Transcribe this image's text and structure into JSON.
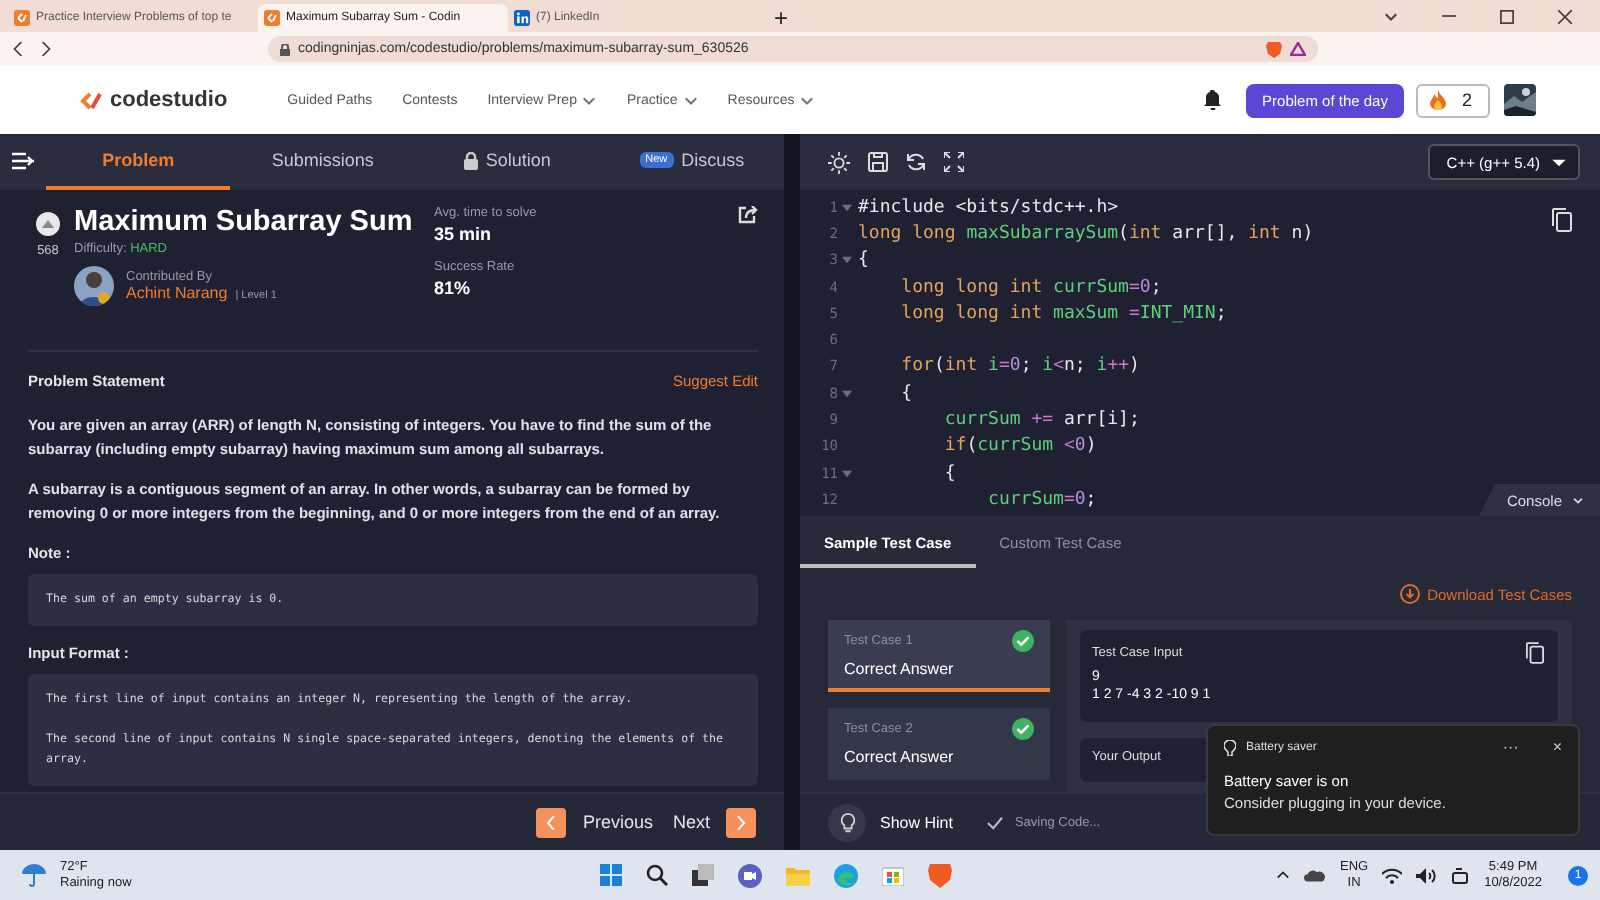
{
  "browser": {
    "tabs": [
      {
        "title": "Practice Interview Problems of top te",
        "selected": false,
        "kind": "codestudio"
      },
      {
        "title": "Maximum Subarray Sum - Codin",
        "selected": true,
        "kind": "codestudio"
      },
      {
        "title": "(7) LinkedIn",
        "selected": false,
        "kind": "linkedin"
      }
    ],
    "new_tab": "+",
    "url": "codingninjas.com/codestudio/problems/maximum-subarray-sum_630526"
  },
  "header": {
    "logo": "codestudio",
    "nav": [
      {
        "label": "Guided Paths",
        "dropdown": false
      },
      {
        "label": "Contests",
        "dropdown": false
      },
      {
        "label": "Interview Prep",
        "dropdown": true
      },
      {
        "label": "Practice",
        "dropdown": true
      },
      {
        "label": "Resources",
        "dropdown": true
      }
    ],
    "problem_of_day": "Problem of the day",
    "streak": "2"
  },
  "workspace_tabs": [
    {
      "label": "Problem",
      "selected": true,
      "kind": "plain"
    },
    {
      "label": "Submissions",
      "selected": false,
      "kind": "plain"
    },
    {
      "label": "Solution",
      "selected": false,
      "kind": "locked"
    },
    {
      "label": "Discuss",
      "selected": false,
      "kind": "badge",
      "badge": "New"
    }
  ],
  "language": "C++ (g++ 5.4)",
  "problem": {
    "title": "Maximum Subarray Sum",
    "number": "568",
    "difficulty_label": "Difficulty:",
    "difficulty": "HARD",
    "contributed_by": "Contributed By",
    "author": "Achint Narang",
    "author_level": "| Level 1",
    "stats": [
      {
        "label": "Avg. time to solve",
        "value": "35 min"
      },
      {
        "label": "Success Rate",
        "value": "81%"
      }
    ],
    "statement_heading": "Problem Statement",
    "suggest_edit": "Suggest Edit",
    "paragraphs": [
      "You are given an array (ARR) of length N, consisting of integers. You have to find the sum of the subarray (including empty subarray) having maximum sum among all subarrays.",
      "A subarray is a contiguous segment of an array. In other words, a subarray can be formed by removing 0 or more integers from the beginning, and 0 or more integers from the end of an array."
    ],
    "sections": [
      {
        "heading": "Note :",
        "lines": [
          "The sum of an empty subarray is 0."
        ]
      },
      {
        "heading": "Input Format :",
        "lines": [
          "The first line of input contains an integer N, representing the length of the array.",
          "The second line of input contains N single space-separated integers, denoting the elements of the array."
        ]
      }
    ],
    "previous": "Previous",
    "next": "Next"
  },
  "editor": {
    "lines": [
      {
        "number": "1",
        "fold": true,
        "tokens": [
          {
            "kind": "plain",
            "text": "#include <bits/stdc++.h>"
          }
        ]
      },
      {
        "number": "2",
        "fold": false,
        "tokens": [
          {
            "kind": "kw",
            "text": "long long "
          },
          {
            "kind": "fn",
            "text": "maxSubarraySum"
          },
          {
            "kind": "plain",
            "text": "("
          },
          {
            "kind": "kw",
            "text": "int"
          },
          {
            "kind": "plain",
            "text": " arr[], "
          },
          {
            "kind": "kw",
            "text": "int"
          },
          {
            "kind": "plain",
            "text": " n)"
          }
        ]
      },
      {
        "number": "3",
        "fold": true,
        "tokens": [
          {
            "kind": "plain",
            "text": "{"
          }
        ]
      },
      {
        "number": "4",
        "fold": false,
        "tokens": [
          {
            "kind": "kw",
            "text": "    long long int "
          },
          {
            "kind": "fn",
            "text": "currSum"
          },
          {
            "kind": "op",
            "text": "="
          },
          {
            "kind": "num",
            "text": "0"
          },
          {
            "kind": "plain",
            "text": ";"
          }
        ]
      },
      {
        "number": "5",
        "fold": false,
        "tokens": [
          {
            "kind": "kw",
            "text": "    long long int "
          },
          {
            "kind": "fn",
            "text": "maxSum "
          },
          {
            "kind": "op",
            "text": "="
          },
          {
            "kind": "fn",
            "text": "INT_MIN"
          },
          {
            "kind": "plain",
            "text": ";"
          }
        ]
      },
      {
        "number": "6",
        "fold": false
      },
      {
        "number": "7",
        "fold": false,
        "tokens": [
          {
            "kind": "kw",
            "text": "    for"
          },
          {
            "kind": "plain",
            "text": "("
          },
          {
            "kind": "kw",
            "text": "int "
          },
          {
            "kind": "fn",
            "text": "i"
          },
          {
            "kind": "op",
            "text": "="
          },
          {
            "kind": "num",
            "text": "0"
          },
          {
            "kind": "plain",
            "text": "; "
          },
          {
            "kind": "fn",
            "text": "i"
          },
          {
            "kind": "op",
            "text": "<"
          },
          {
            "kind": "plain",
            "text": "n; "
          },
          {
            "kind": "fn",
            "text": "i"
          },
          {
            "kind": "op",
            "text": "++"
          },
          {
            "kind": "plain",
            "text": ")"
          }
        ]
      },
      {
        "number": "8",
        "fold": true,
        "tokens": [
          {
            "kind": "plain",
            "text": "    {"
          }
        ]
      },
      {
        "number": "9",
        "fold": false,
        "tokens": [
          {
            "kind": "fn",
            "text": "        currSum "
          },
          {
            "kind": "op",
            "text": "+="
          },
          {
            "kind": "plain",
            "text": " arr[i];"
          }
        ]
      },
      {
        "number": "10",
        "fold": false,
        "tokens": [
          {
            "kind": "kw",
            "text": "        if"
          },
          {
            "kind": "plain",
            "text": "("
          },
          {
            "kind": "fn",
            "text": "currSum "
          },
          {
            "kind": "op",
            "text": "<"
          },
          {
            "kind": "num",
            "text": "0"
          },
          {
            "kind": "plain",
            "text": ")"
          }
        ]
      },
      {
        "number": "11",
        "fold": true,
        "tokens": [
          {
            "kind": "plain",
            "text": "        {"
          }
        ]
      },
      {
        "number": "12",
        "fold": false,
        "tokens": [
          {
            "kind": "fn",
            "text": "            currSum"
          },
          {
            "kind": "op",
            "text": "="
          },
          {
            "kind": "num",
            "text": "0"
          },
          {
            "kind": "plain",
            "text": ";"
          }
        ]
      }
    ]
  },
  "console": {
    "toggle": "Console",
    "tabs": [
      {
        "label": "Sample Test Case",
        "selected": true
      },
      {
        "label": "Custom Test Case",
        "selected": false
      }
    ],
    "download": "Download Test Cases",
    "cases": [
      {
        "label": "Test Case 1",
        "result": "Correct Answer",
        "passed": true,
        "selected": true
      },
      {
        "label": "Test Case 2",
        "result": "Correct Answer",
        "passed": true,
        "selected": false
      }
    ],
    "input_label": "Test Case Input",
    "input_lines": [
      "9",
      "1 2 7 -4 3 2 -10 9 1"
    ],
    "output_label": "Your Output",
    "show_hint": "Show Hint",
    "saving": "Saving Code..."
  },
  "toast": {
    "title": "Battery saver",
    "more": "···",
    "close": "×",
    "heading": "Battery saver is on",
    "message": "Consider plugging in your device."
  },
  "taskbar": {
    "temperature": "72°F",
    "weather": "Raining now",
    "language": "ENG",
    "region": "IN",
    "time": "5:49 PM",
    "date": "10/8/2022",
    "notifications": "1"
  }
}
